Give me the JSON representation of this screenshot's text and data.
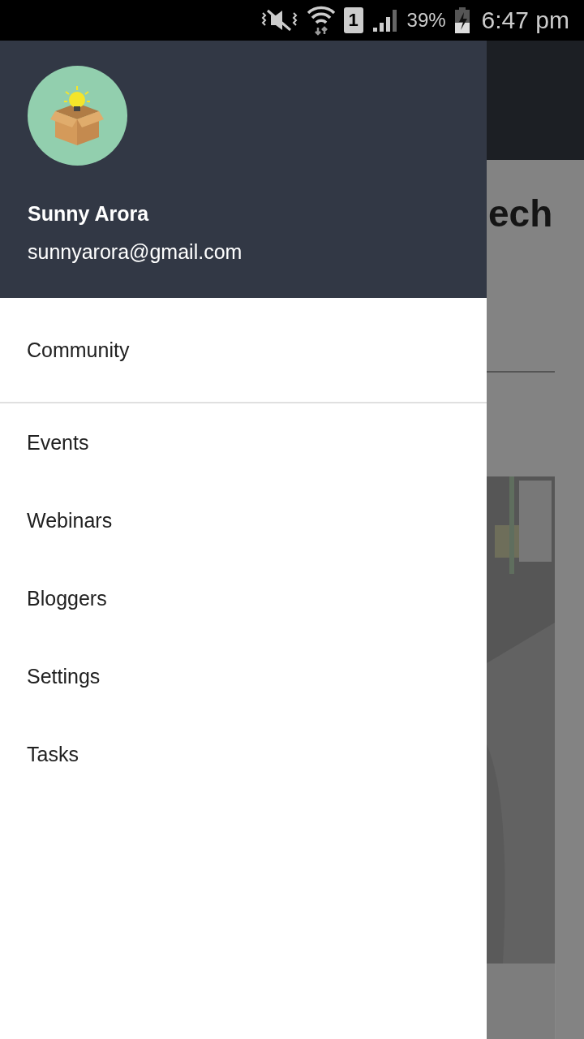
{
  "status_bar": {
    "sim": "1",
    "battery": "39%",
    "time": "6:47 pm"
  },
  "drawer": {
    "header": {
      "name": "Sunny Arora",
      "email": "sunnyarora@gmail.com"
    },
    "sections": [
      [
        {
          "label": "Community"
        }
      ],
      [
        {
          "label": "Events"
        },
        {
          "label": "Webinars"
        },
        {
          "label": "Bloggers"
        },
        {
          "label": "Settings"
        },
        {
          "label": "Tasks"
        }
      ]
    ]
  },
  "background": {
    "title": "ech"
  }
}
